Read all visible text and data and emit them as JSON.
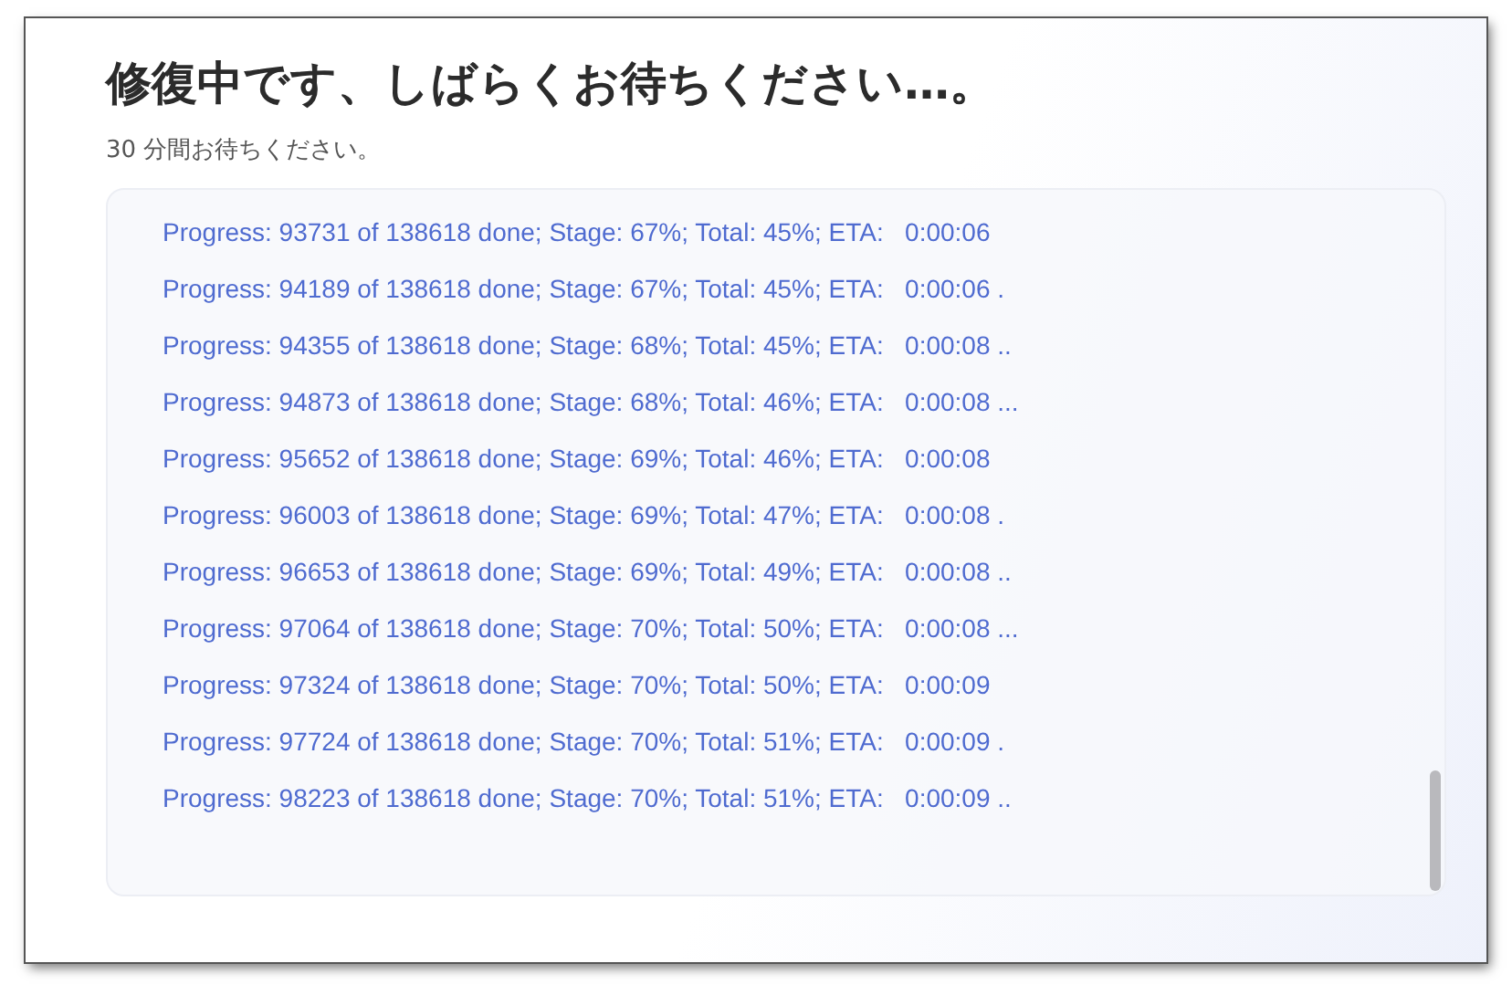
{
  "title": "修復中です、しばらくお待ちください…。",
  "subtitle": "30 分間お待ちください。",
  "log_lines": [
    "Progress: 93731 of 138618 done; Stage: 67%; Total: 45%; ETA:   0:00:06",
    "Progress: 94189 of 138618 done; Stage: 67%; Total: 45%; ETA:   0:00:06 .",
    "Progress: 94355 of 138618 done; Stage: 68%; Total: 45%; ETA:   0:00:08 ..",
    "Progress: 94873 of 138618 done; Stage: 68%; Total: 46%; ETA:   0:00:08 ...",
    "Progress: 95652 of 138618 done; Stage: 69%; Total: 46%; ETA:   0:00:08",
    "Progress: 96003 of 138618 done; Stage: 69%; Total: 47%; ETA:   0:00:08 .",
    "Progress: 96653 of 138618 done; Stage: 69%; Total: 49%; ETA:   0:00:08 ..",
    "Progress: 97064 of 138618 done; Stage: 70%; Total: 50%; ETA:   0:00:08 ...",
    "Progress: 97324 of 138618 done; Stage: 70%; Total: 50%; ETA:   0:00:09",
    "Progress: 97724 of 138618 done; Stage: 70%; Total: 51%; ETA:   0:00:09 .",
    "Progress: 98223 of 138618 done; Stage: 70%; Total: 51%; ETA:   0:00:09 .."
  ]
}
